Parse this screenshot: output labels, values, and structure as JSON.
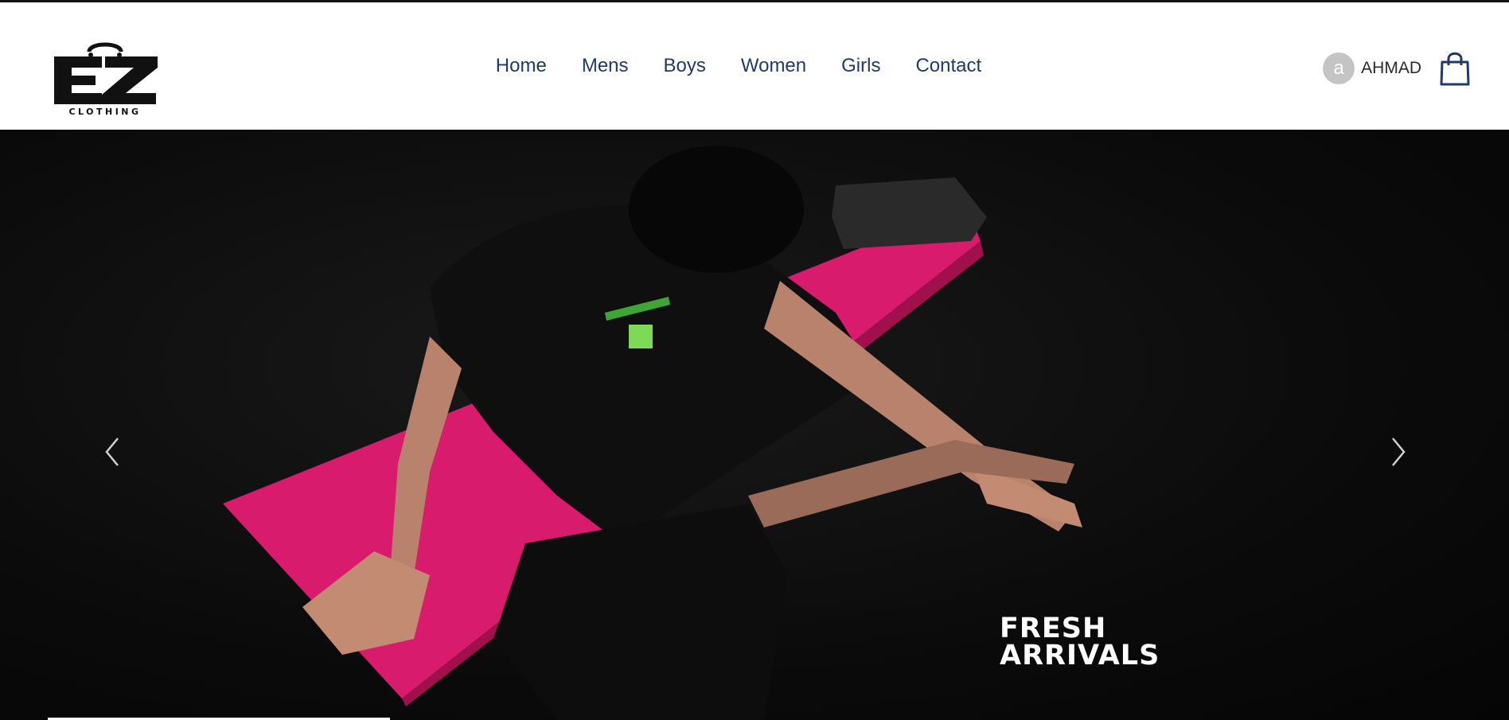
{
  "brand": {
    "logo_text": "EZ",
    "logo_subtext": "CLOTHING"
  },
  "nav": {
    "items": [
      {
        "label": "Home"
      },
      {
        "label": "Mens"
      },
      {
        "label": "Boys"
      },
      {
        "label": "Women"
      },
      {
        "label": "Girls"
      },
      {
        "label": "Contact"
      }
    ]
  },
  "user": {
    "avatar_initial": "a",
    "name": "AHMAD"
  },
  "icons": {
    "cart": "shopping-bag-icon",
    "prev": "chevron-left-icon",
    "next": "chevron-right-icon"
  },
  "hero": {
    "caption_line1": "FRESH",
    "caption_line2": "ARRIVALS"
  },
  "colors": {
    "nav_text": "#1f3a68",
    "accent_pink": "#e0186f",
    "background_dark": "#0b0b0b"
  }
}
